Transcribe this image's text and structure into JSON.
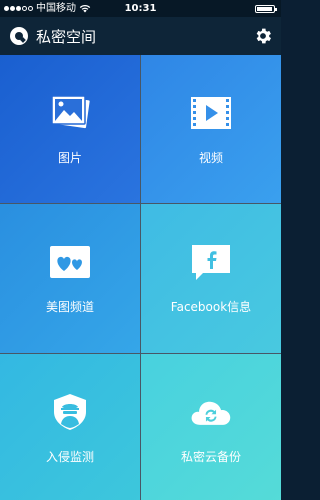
{
  "status_bar": {
    "carrier": "中国移动",
    "time": "10:31"
  },
  "nav": {
    "title": "私密空间",
    "settings_icon": "gear-icon"
  },
  "tiles": [
    {
      "label": "图片",
      "icon": "photos-icon"
    },
    {
      "label": "视频",
      "icon": "video-icon"
    },
    {
      "label": "美图频道",
      "icon": "hearts-icon"
    },
    {
      "label": "Facebook信息",
      "icon": "facebook-chat-icon"
    },
    {
      "label": "入侵监测",
      "icon": "intruder-shield-icon"
    },
    {
      "label": "私密云备份",
      "icon": "cloud-sync-icon"
    }
  ]
}
